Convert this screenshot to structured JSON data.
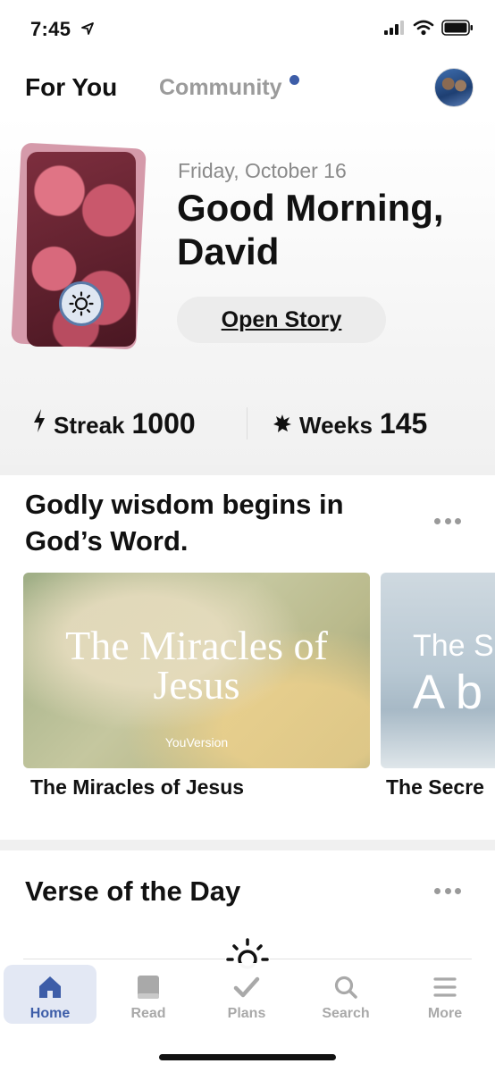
{
  "status_bar": {
    "time": "7:45",
    "icons": [
      "location-arrow-icon",
      "signal-icon",
      "wifi-icon",
      "battery-icon"
    ]
  },
  "top_tabs": {
    "for_you": "For You",
    "community": "Community"
  },
  "hero": {
    "date": "Friday, October 16",
    "greeting": "Good Morning, David",
    "open_story": "Open Story",
    "streak_label": "Streak",
    "streak_value": "1000",
    "weeks_label": "Weeks",
    "weeks_value": "145"
  },
  "plans_section": {
    "title": "Godly wisdom begins in God’s Word.",
    "cards": [
      {
        "image_title": "The Miracles of Jesus",
        "brand": "YouVersion",
        "name": "The Miracles of Jesus"
      },
      {
        "image_title_line1": "The S",
        "image_title_line2": "A b",
        "name": "The Secre"
      }
    ]
  },
  "verse_of_day": {
    "title": "Verse of the Day"
  },
  "bottom_nav": {
    "items": [
      {
        "label": "Home",
        "icon": "home-icon",
        "active": true
      },
      {
        "label": "Read",
        "icon": "book-icon",
        "active": false
      },
      {
        "label": "Plans",
        "icon": "checkmark-icon",
        "active": false
      },
      {
        "label": "Search",
        "icon": "search-icon",
        "active": false
      },
      {
        "label": "More",
        "icon": "menu-icon",
        "active": false
      }
    ]
  },
  "colors": {
    "accent": "#3d5da8",
    "inactive": "#a9a9a9"
  }
}
